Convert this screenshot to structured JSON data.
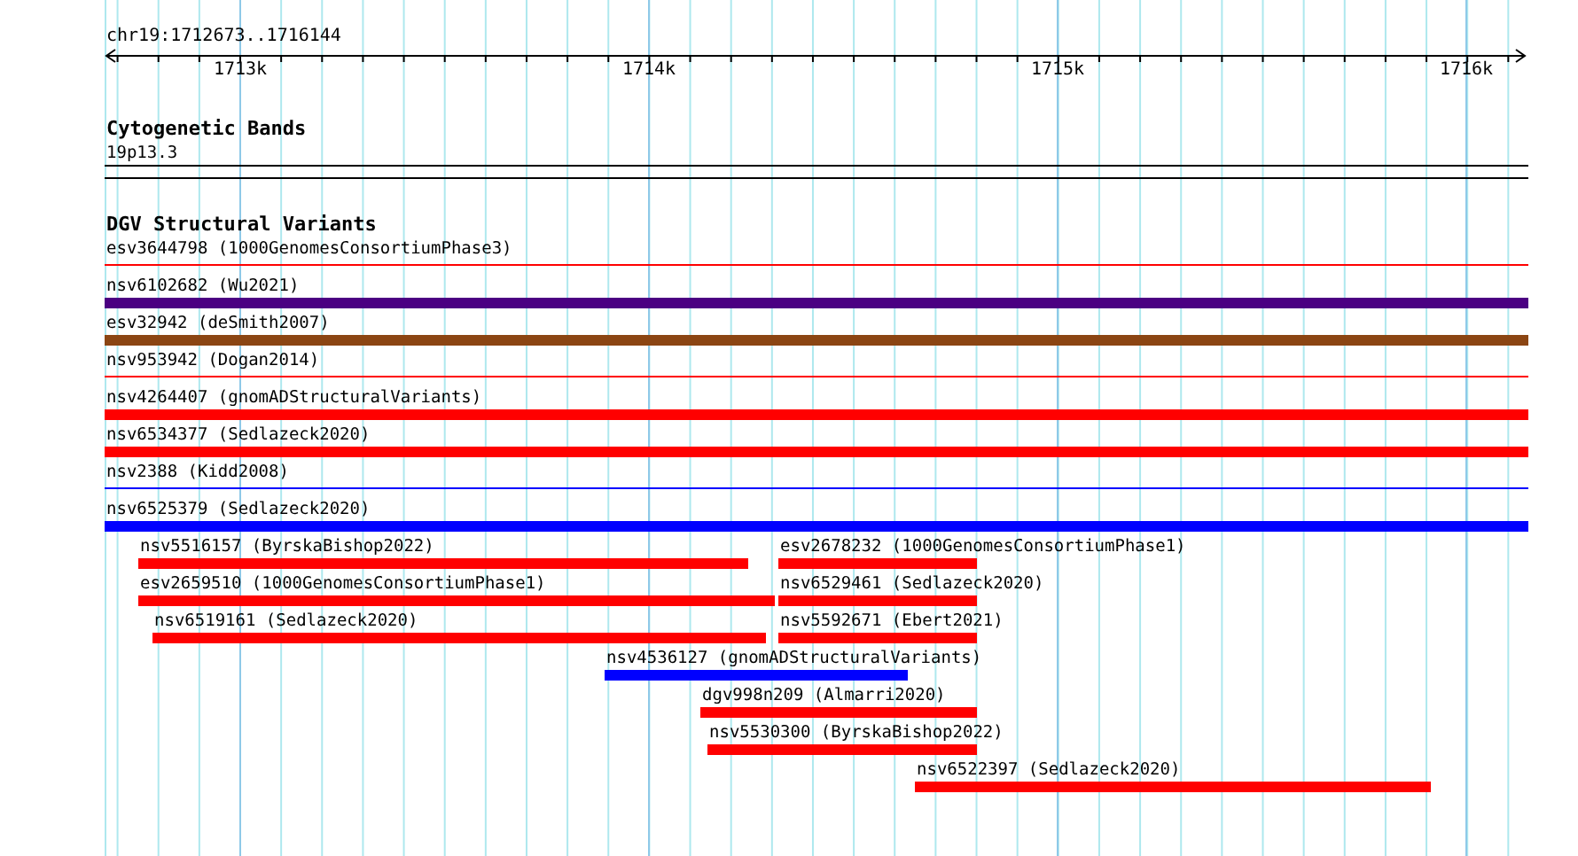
{
  "ruler": {
    "location": "chr19:1712673..1716144",
    "tick_labels": [
      "1713k",
      "1714k",
      "1715k",
      "1716k"
    ]
  },
  "tracks": [
    {
      "title": "Cytogenetic Bands",
      "features": [
        {
          "label": "19p13.3",
          "kind": "band"
        }
      ]
    },
    {
      "title": "DGV Structural Variants",
      "features": [
        {
          "label": "esv3644798 (1000GenomesConsortiumPhase3)",
          "kind": "line",
          "color": "#ff0000"
        },
        {
          "label": "nsv6102682 (Wu2021)",
          "kind": "bar",
          "color": "#4b0082"
        },
        {
          "label": "esv32942 (deSmith2007)",
          "kind": "bar",
          "color": "#8b4513"
        },
        {
          "label": "nsv953942 (Dogan2014)",
          "kind": "line",
          "color": "#ff0000"
        },
        {
          "label": "nsv4264407 (gnomADStructuralVariants)",
          "kind": "bar",
          "color": "#ff0000"
        },
        {
          "label": "nsv6534377 (Sedlazeck2020)",
          "kind": "bar",
          "color": "#ff0000"
        },
        {
          "label": "nsv2388 (Kidd2008)",
          "kind": "line",
          "color": "#0000ff"
        },
        {
          "label": "nsv6525379 (Sedlazeck2020)",
          "kind": "bar",
          "color": "#0000ff"
        },
        {
          "label": "nsv5516157 (ByrskaBishop2022)",
          "kind": "bar",
          "color": "#ff0000"
        },
        {
          "label": "esv2678232 (1000GenomesConsortiumPhase1)",
          "kind": "bar",
          "color": "#ff0000"
        },
        {
          "label": "esv2659510 (1000GenomesConsortiumPhase1)",
          "kind": "bar",
          "color": "#ff0000"
        },
        {
          "label": "nsv6529461 (Sedlazeck2020)",
          "kind": "bar",
          "color": "#ff0000"
        },
        {
          "label": "nsv6519161 (Sedlazeck2020)",
          "kind": "bar",
          "color": "#ff0000"
        },
        {
          "label": "nsv5592671 (Ebert2021)",
          "kind": "bar",
          "color": "#ff0000"
        },
        {
          "label": "nsv4536127 (gnomADStructuralVariants)",
          "kind": "bar",
          "color": "#0000ff"
        },
        {
          "label": "dgv998n209 (Almarri2020)",
          "kind": "bar",
          "color": "#ff0000"
        },
        {
          "label": "nsv5530300 (ByrskaBishop2022)",
          "kind": "bar",
          "color": "#ff0000"
        },
        {
          "label": "nsv6522397 (Sedlazeck2020)",
          "kind": "bar",
          "color": "#ff0000"
        }
      ]
    }
  ]
}
